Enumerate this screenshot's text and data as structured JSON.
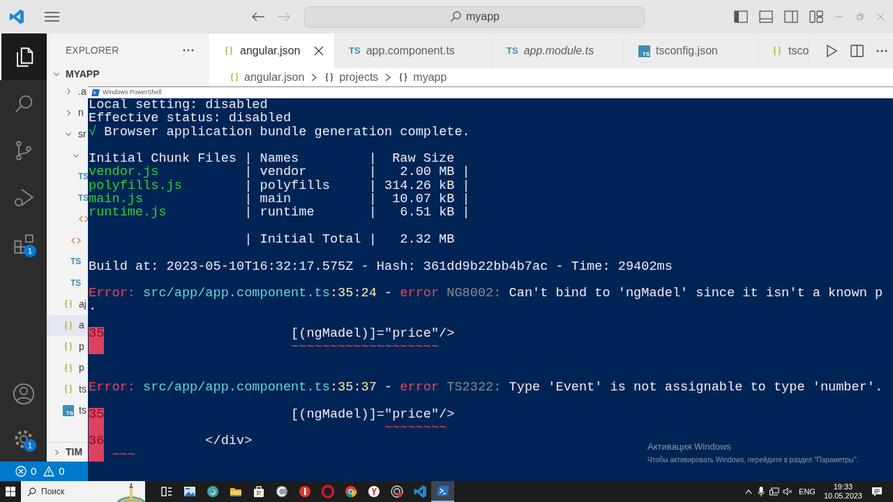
{
  "titlebar": {
    "nav": [
      {
        "kind": "back",
        "disabled": false
      },
      {
        "kind": "forward",
        "disabled": true
      }
    ],
    "search": "myapp"
  },
  "activity_bar": {
    "items": [
      {
        "kind": "explorer",
        "selected": true
      },
      {
        "kind": "search",
        "selected": false
      },
      {
        "kind": "source-control",
        "selected": false
      },
      {
        "kind": "run-debug",
        "selected": false
      },
      {
        "kind": "extensions",
        "selected": false,
        "badge": "1"
      }
    ],
    "bottom": [
      {
        "kind": "account",
        "selected": false
      },
      {
        "kind": "settings",
        "selected": false,
        "badge": "1"
      }
    ]
  },
  "sidebar": {
    "title": "EXPLORER",
    "section": "MYAPP",
    "section_expanded": true,
    "tree": [
      {
        "kind": "folder",
        "name": ".a",
        "expanded": false,
        "selected": false
      },
      {
        "kind": "folder",
        "name": "n",
        "expanded": false,
        "selected": false
      },
      {
        "kind": "folder",
        "name": "sr",
        "expanded": true,
        "selected": false,
        "children": [
          {
            "kind": "folder",
            "expanded": true,
            "selected": false,
            "children": [
              {
                "kind": "ts",
                "icon_text": "TS",
                "selected": false
              },
              {
                "kind": "ts",
                "icon_text": "TS",
                "selected": false
              },
              {
                "kind": "html",
                "selected": false
              }
            ]
          },
          {
            "kind": "html",
            "selected": false
          },
          {
            "kind": "ts",
            "icon_text": "TS",
            "selected": false
          },
          {
            "kind": "ts",
            "icon_text": "TS",
            "selected": false
          }
        ]
      },
      {
        "kind": "json",
        "name": "aj",
        "selected": false
      },
      {
        "kind": "json",
        "name": "a",
        "selected": true
      },
      {
        "kind": "json",
        "name": "p",
        "selected": false
      },
      {
        "kind": "json",
        "name": "p",
        "selected": false
      },
      {
        "kind": "json",
        "name": "ts",
        "selected": false
      },
      {
        "kind": "tsconfig",
        "icon_text": "TS",
        "name": "ts",
        "selected": false
      }
    ],
    "bottom_section": "TIM",
    "bottom_expanded": false
  },
  "tabs": [
    {
      "label": "angular.json",
      "kind": "json",
      "selected": true,
      "preview": false
    },
    {
      "label": "app.component.ts",
      "kind": "ts",
      "icon_text": "TS",
      "selected": false,
      "preview": false
    },
    {
      "label": "app.module.ts",
      "kind": "ts",
      "icon_text": "TS",
      "selected": false,
      "preview": true
    },
    {
      "label": "tsconfig.json",
      "kind": "tsconfig",
      "icon_text": "TS",
      "selected": false,
      "preview": false
    },
    {
      "label": "tsco",
      "kind": "json",
      "selected": false,
      "preview": false
    }
  ],
  "breadcrumb": [
    {
      "label": "angular.json",
      "kind": "json"
    },
    {
      "label": "projects",
      "kind": "object"
    },
    {
      "label": "myapp",
      "kind": "object"
    }
  ],
  "status_bar": {
    "errors": "0",
    "warnings": "0"
  },
  "terminal": {
    "title": "Windows PowerShell",
    "lines": [
      {
        "marked": false,
        "segments": [
          {
            "text": "Local setting: disabled",
            "kind": "plain"
          }
        ]
      },
      {
        "marked": false,
        "segments": [
          {
            "text": "Effective status: disabled",
            "kind": "plain"
          }
        ]
      },
      {
        "marked": false,
        "segments": [
          {
            "text": "√",
            "kind": "ok"
          },
          {
            "text": " Browser application bundle generation complete.",
            "kind": "plain"
          }
        ]
      },
      {
        "marked": false
      },
      {
        "marked": false,
        "segments": [
          {
            "text": "Initial Chunk Files | Names         |  Raw Size",
            "kind": "plain"
          }
        ]
      },
      {
        "marked": false,
        "segments": [
          {
            "text": "vendor.js",
            "kind": "file"
          },
          {
            "text": "           | vendor        |   2.00 MB |",
            "kind": "plain"
          }
        ]
      },
      {
        "marked": false,
        "segments": [
          {
            "text": "polyfills.js",
            "kind": "file"
          },
          {
            "text": "        | polyfills     | 314.26 kB |",
            "kind": "plain"
          }
        ]
      },
      {
        "marked": false,
        "segments": [
          {
            "text": "main.js",
            "kind": "file"
          },
          {
            "text": "             | main          |  10.07 kB |",
            "kind": "plain"
          }
        ]
      },
      {
        "marked": false,
        "segments": [
          {
            "text": "runtime.js",
            "kind": "file"
          },
          {
            "text": "          | runtime       |   6.51 kB |",
            "kind": "plain"
          }
        ]
      },
      {
        "marked": false
      },
      {
        "marked": false,
        "segments": [
          {
            "text": "                    | Initial Total |   2.32 MB",
            "kind": "plain"
          }
        ]
      },
      {
        "marked": false
      },
      {
        "marked": false,
        "segments": [
          {
            "text": "Build at: 2023-05-10T16:32:17.575Z - Hash: 361dd9b22bb4b7ac - Time: 29402ms",
            "kind": "plain"
          }
        ]
      },
      {
        "marked": false
      },
      {
        "marked": false,
        "segments": [
          {
            "text": "Error: ",
            "kind": "error"
          },
          {
            "text": "src/app/app.component.ts",
            "kind": "path"
          },
          {
            "text": ":35:24",
            "kind": "location"
          },
          {
            "text": " - ",
            "kind": "plain"
          },
          {
            "text": "error",
            "kind": "error"
          },
          {
            "text": " NG8002:",
            "kind": "code"
          },
          {
            "text": " Can't bind to 'ngMadel' since it isn't a known p",
            "kind": "plain"
          }
        ]
      },
      {
        "marked": false,
        "segments": [
          {
            "text": ".",
            "kind": "plain"
          }
        ]
      },
      {
        "marked": false
      },
      {
        "marked": true,
        "gutter": "35",
        "segments": [
          {
            "text": "                        [(ngMadel)]=\"price\"/>",
            "kind": "plain"
          }
        ]
      },
      {
        "marked": true,
        "segments": [
          {
            "text": "                        ~~~~~~~~~~~~~~~~~~~",
            "kind": "squiggle"
          }
        ]
      },
      {
        "marked": false
      },
      {
        "marked": false
      },
      {
        "marked": false,
        "segments": [
          {
            "text": "Error: ",
            "kind": "error"
          },
          {
            "text": "src/app/app.component.ts",
            "kind": "path"
          },
          {
            "text": ":35:37",
            "kind": "location"
          },
          {
            "text": " - ",
            "kind": "plain"
          },
          {
            "text": "error",
            "kind": "error"
          },
          {
            "text": " TS2322:",
            "kind": "code"
          },
          {
            "text": " Type 'Event' is not assignable to type 'number'.",
            "kind": "plain"
          }
        ]
      },
      {
        "marked": false
      },
      {
        "marked": true,
        "gutter": "35",
        "segments": [
          {
            "text": "                        [(ngMadel)]=\"price\"/>",
            "kind": "plain"
          }
        ]
      },
      {
        "marked": true,
        "segments": [
          {
            "text": "                                    ~~~~~~~~",
            "kind": "squiggle"
          }
        ]
      },
      {
        "marked": true,
        "gutter": "36",
        "segments": [
          {
            "text": "             </div>",
            "kind": "plain"
          }
        ]
      },
      {
        "marked": true,
        "segments": [
          {
            "text": " ~~~",
            "kind": "squiggle"
          }
        ]
      }
    ]
  },
  "activation": {
    "title": "Активация Windows",
    "text": "Чтобы активировать Windows, перейдите в раздел \"Параметры\"."
  },
  "taskbar": {
    "search_placeholder": "Поиск",
    "apps": [
      {
        "kind": "task-view",
        "selected": false
      },
      {
        "kind": "image-viewer",
        "selected": false
      },
      {
        "kind": "edge",
        "selected": false
      },
      {
        "kind": "file-explorer",
        "selected": false
      },
      {
        "kind": "store",
        "selected": false
      },
      {
        "kind": "ccleaner",
        "selected": false
      },
      {
        "kind": "yandex",
        "selected": false
      },
      {
        "kind": "opera",
        "selected": false
      },
      {
        "kind": "chrome",
        "selected": false
      },
      {
        "kind": "yandex-browser",
        "selected": false
      },
      {
        "kind": "obs",
        "selected": false
      },
      {
        "kind": "vscode",
        "selected": false
      },
      {
        "kind": "powershell",
        "selected": true
      }
    ],
    "language": "ENG",
    "time": "19:33",
    "date": "10.05.2023"
  }
}
